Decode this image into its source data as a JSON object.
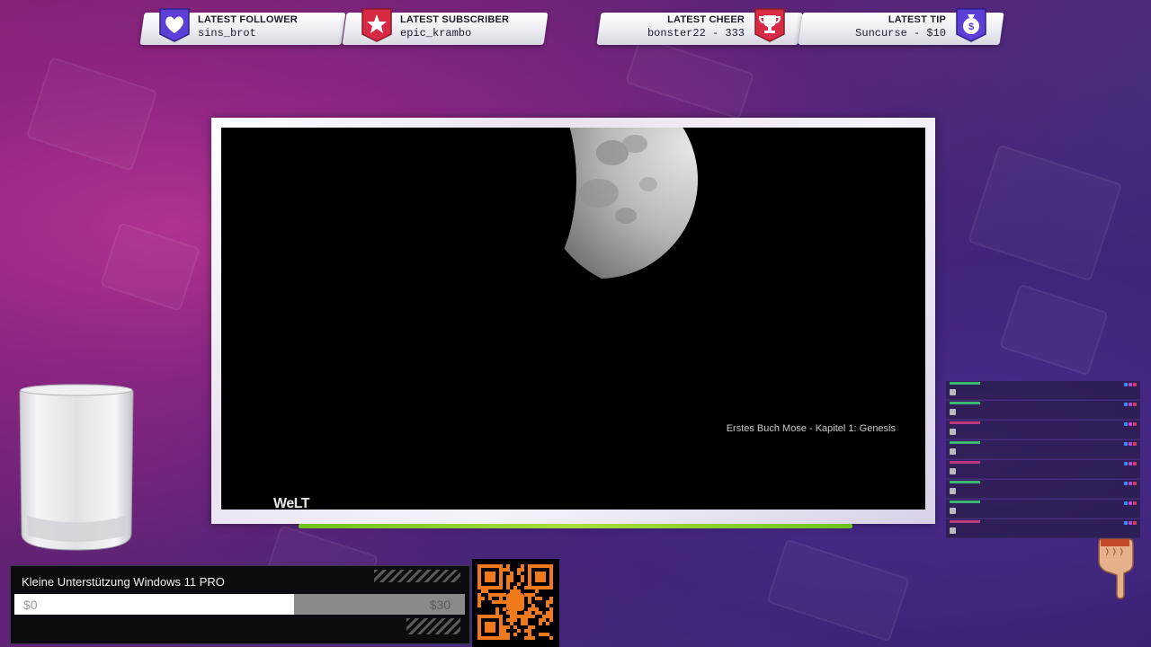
{
  "alerts": {
    "follower": {
      "title": "LATEST FOLLOWER",
      "value": "sins_brot",
      "icon": "heart-icon",
      "color": "#5b3fd6"
    },
    "subscriber": {
      "title": "LATEST SUBSCRIBER",
      "value": "epic_krambo",
      "icon": "star-icon",
      "color": "#d62a45"
    },
    "cheer": {
      "title": "LATEST CHEER",
      "value": "bonster22 - 333",
      "icon": "trophy-icon",
      "color": "#d62a45"
    },
    "tip": {
      "title": "LATEST TIP",
      "value": "Suncurse - $10",
      "icon": "money-bag-icon",
      "color": "#5b3fd6"
    }
  },
  "video": {
    "caption": "Erstes Buch Mose - Kapitel 1: Genesis",
    "watermark": "WeLT"
  },
  "goal": {
    "title": "Kleine Unterstützung Windows 11 PRO",
    "start_label": "$0",
    "end_label": "$30",
    "progress_fraction": 0.62
  },
  "chat": {
    "messages": [
      {
        "name_color": "#3ee07a"
      },
      {
        "name_color": "#3ee07a"
      },
      {
        "name_color": "#e0408a"
      },
      {
        "name_color": "#3ee07a"
      },
      {
        "name_color": "#e0408a"
      },
      {
        "name_color": "#3ee07a"
      },
      {
        "name_color": "#3ee07a"
      },
      {
        "name_color": "#e0408a"
      }
    ]
  },
  "colors": {
    "accent_green": "#8ed42a",
    "background_purple": "#6a2478"
  }
}
